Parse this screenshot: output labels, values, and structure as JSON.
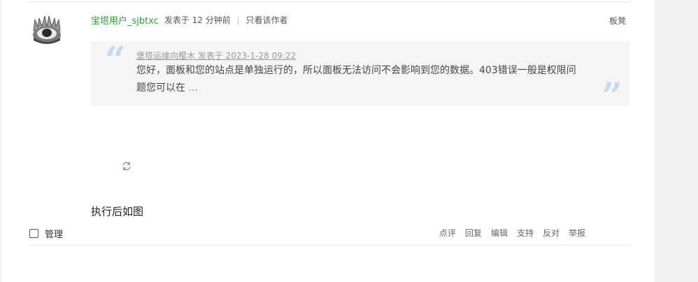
{
  "post": {
    "username": "宝塔用户_sjbtxc",
    "posted_time": "发表于 12 分钟前",
    "separator": "|",
    "author_only": "只看该作者",
    "floor": "板凳"
  },
  "quote": {
    "header": "堡塔运维向樱木 发表于 2023-1-28 09:22",
    "body": "您好，面板和您的站点是单独运行的，所以面板无法访问不会影响到您的数据。403错误一般是权限问题您可以在",
    "ellipsis": " ..."
  },
  "content": {
    "text": "执行后如图",
    "image_icon": "refresh-icon"
  },
  "footer": {
    "manage_label": "管理",
    "actions": [
      "点评",
      "回复",
      "编辑",
      "支持",
      "反对",
      "举报"
    ]
  },
  "colors": {
    "username": "#2e9d3a",
    "quote_background": "#f5f5f5",
    "quote_mark": "#c7dbee"
  }
}
